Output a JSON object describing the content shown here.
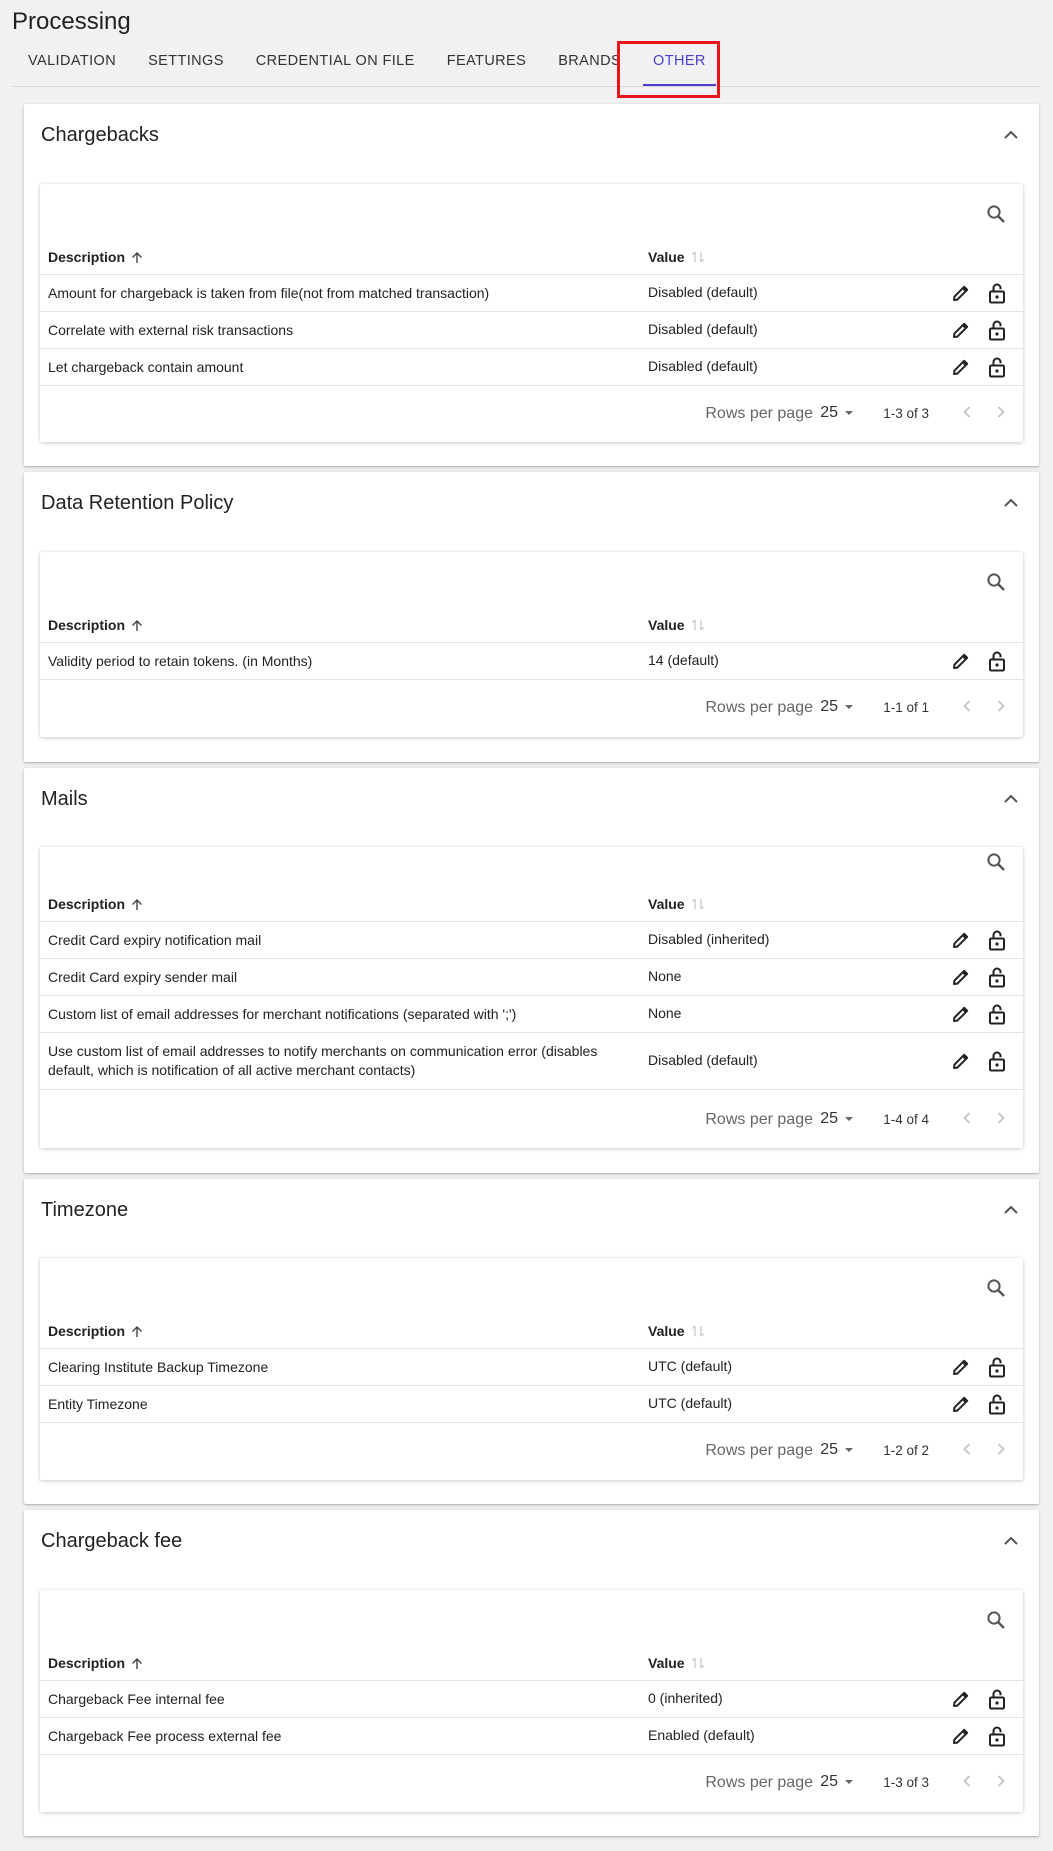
{
  "page": {
    "title": "Processing"
  },
  "tabs": [
    {
      "label": "VALIDATION",
      "active": false
    },
    {
      "label": "SETTINGS",
      "active": false
    },
    {
      "label": "CREDENTIAL ON FILE",
      "active": false
    },
    {
      "label": "FEATURES",
      "active": false
    },
    {
      "label": "BRANDS",
      "active": false
    },
    {
      "label": "OTHER",
      "active": true
    }
  ],
  "colors": {
    "accent": "#4a3fcf",
    "highlight": "#e8161c",
    "background": "#f1f1f3"
  },
  "columns": {
    "description": "Description",
    "value": "Value"
  },
  "pagination": {
    "rows_per_page_label": "Rows per page",
    "rows_per_page_value": "25"
  },
  "icons": [
    "chevron-up-icon",
    "search-icon",
    "sort-arrow-up-icon",
    "sort-unsorted-icon",
    "edit-pencil-icon",
    "unlock-icon",
    "dropdown-arrow-icon",
    "chevron-left-icon",
    "chevron-right-icon"
  ],
  "sections": [
    {
      "title": "Chargebacks",
      "range": "1-3 of 3",
      "rows": [
        {
          "description": "Amount for chargeback is taken from file(not from matched transaction)",
          "value": "Disabled (default)"
        },
        {
          "description": "Correlate with external risk transactions",
          "value": "Disabled (default)"
        },
        {
          "description": "Let chargeback contain amount",
          "value": "Disabled (default)"
        }
      ]
    },
    {
      "title": "Data Retention Policy",
      "range": "1-1 of 1",
      "rows": [
        {
          "description": "Validity period to retain tokens. (in Months)",
          "value": "14 (default)"
        }
      ]
    },
    {
      "title": "Mails",
      "range": "1-4 of 4",
      "rows": [
        {
          "description": "Credit Card expiry notification mail",
          "value": "Disabled (inherited)"
        },
        {
          "description": "Credit Card expiry sender mail",
          "value": "None"
        },
        {
          "description": "Custom list of email addresses for merchant notifications (separated with ';')",
          "value": "None"
        },
        {
          "description": "Use custom list of email addresses to notify merchants on communication error (disables default, which is notification of all active merchant contacts)",
          "value": "Disabled (default)"
        }
      ]
    },
    {
      "title": "Timezone",
      "range": "1-2 of 2",
      "rows": [
        {
          "description": "Clearing Institute Backup Timezone",
          "value": "UTC (default)"
        },
        {
          "description": "Entity Timezone",
          "value": "UTC (default)"
        }
      ]
    },
    {
      "title": "Chargeback fee",
      "range": "1-3 of 3",
      "rows": [
        {
          "description": "Chargeback Fee internal fee",
          "value": "0 (inherited)"
        },
        {
          "description": "Chargeback Fee process external fee",
          "value": "Enabled (default)"
        }
      ]
    }
  ]
}
